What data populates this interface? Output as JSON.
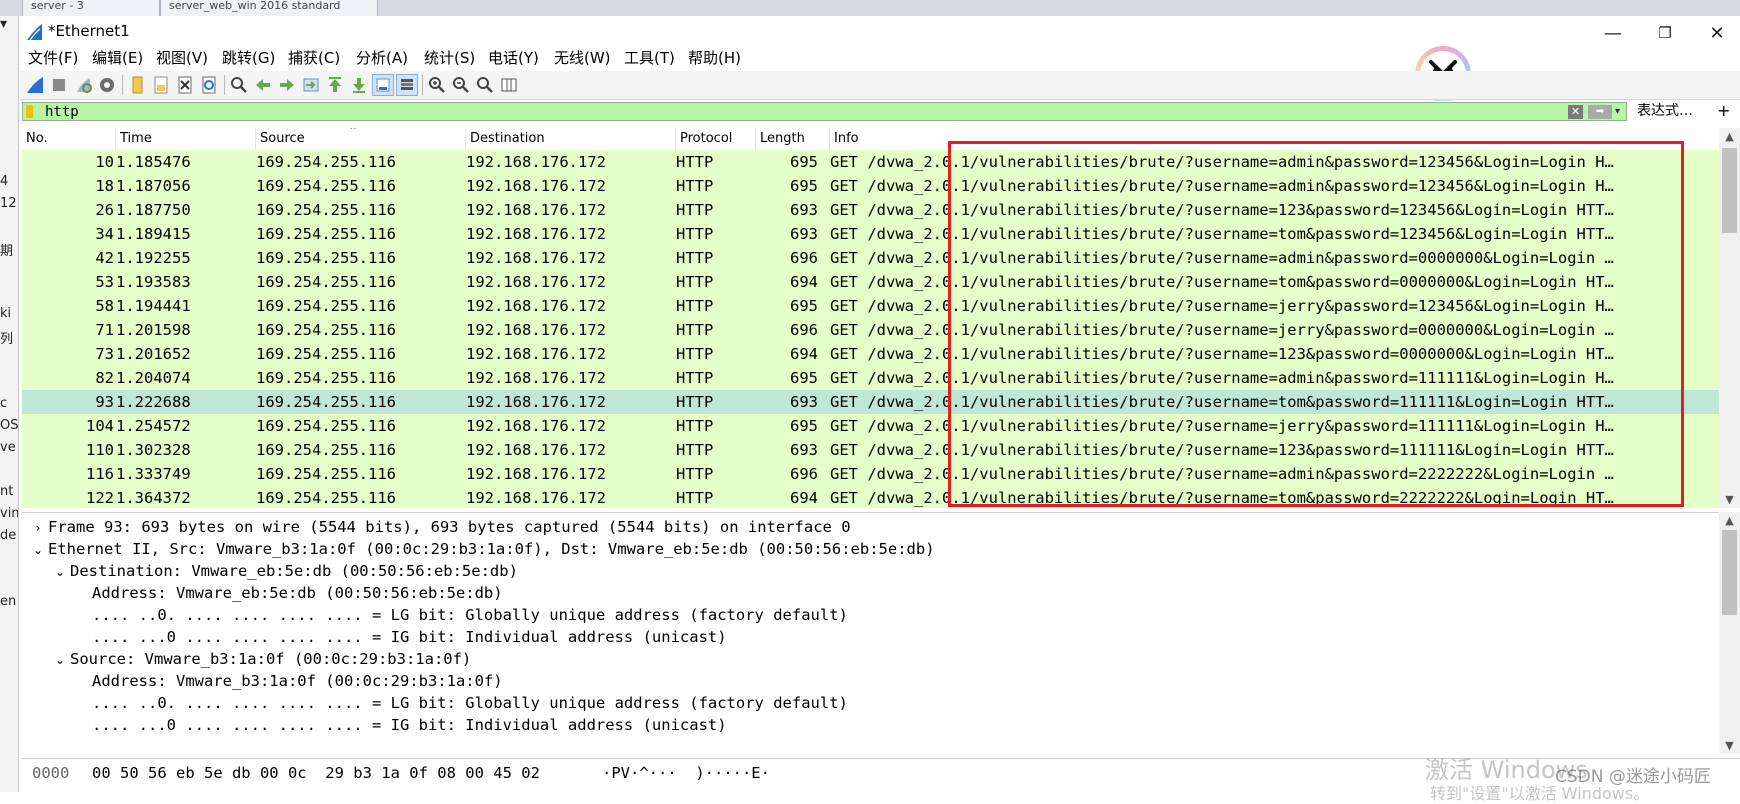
{
  "browser_tabs": [
    {
      "label": "server - 3"
    },
    {
      "label": "server_web_win 2016 standard"
    }
  ],
  "left_edge_text": [
    "4",
    "12",
    "期",
    "ki",
    "列",
    "c",
    "OS",
    "ve",
    "nt",
    "vin",
    "de",
    "en"
  ],
  "window": {
    "title": "*Ethernet1",
    "minimize": "—",
    "restore": "❐",
    "close": "✕"
  },
  "menu": [
    "文件(F)",
    "编辑(E)",
    "视图(V)",
    "跳转(G)",
    "捕获(C)",
    "分析(A)",
    "统计(S)",
    "电话(Y)",
    "无线(W)",
    "工具(T)",
    "帮助(H)"
  ],
  "toolbar_icons": [
    "shark-fin-start-icon",
    "stop-square-icon",
    "restart-capture-icon",
    "capture-options-gear-icon",
    "open-file-icon",
    "save-file-icon",
    "close-file-icon",
    "reload-file-icon",
    "find-packet-icon",
    "go-back-icon",
    "go-forward-icon",
    "go-to-packet-icon",
    "go-first-icon",
    "go-last-icon",
    "autoscroll-icon",
    "colorize-icon",
    "zoom-in-icon",
    "zoom-out-icon",
    "zoom-normal-icon",
    "resize-columns-icon"
  ],
  "filter": {
    "value": "http",
    "clear": "✕",
    "apply": "➡",
    "dropdown": "▾",
    "expression_label": "表达式…",
    "add_label": "+"
  },
  "columns": [
    "No.",
    "Time",
    "Source",
    "Destination",
    "Protocol",
    "Length",
    "Info"
  ],
  "sort_indicator": "⌃",
  "packets": [
    {
      "no": "10",
      "time": "1.185476",
      "src": "169.254.255.116",
      "dst": "192.168.176.172",
      "proto": "HTTP",
      "len": "695",
      "info": "GET /dvwa_2.0.1/vulnerabilities/brute/?username=admin&password=123456&Login=Login H…",
      "selected": false
    },
    {
      "no": "18",
      "time": "1.187056",
      "src": "169.254.255.116",
      "dst": "192.168.176.172",
      "proto": "HTTP",
      "len": "695",
      "info": "GET /dvwa_2.0.1/vulnerabilities/brute/?username=admin&password=123456&Login=Login H…",
      "selected": false
    },
    {
      "no": "26",
      "time": "1.187750",
      "src": "169.254.255.116",
      "dst": "192.168.176.172",
      "proto": "HTTP",
      "len": "693",
      "info": "GET /dvwa_2.0.1/vulnerabilities/brute/?username=123&password=123456&Login=Login HTT…",
      "selected": false
    },
    {
      "no": "34",
      "time": "1.189415",
      "src": "169.254.255.116",
      "dst": "192.168.176.172",
      "proto": "HTTP",
      "len": "693",
      "info": "GET /dvwa_2.0.1/vulnerabilities/brute/?username=tom&password=123456&Login=Login HTT…",
      "selected": false
    },
    {
      "no": "42",
      "time": "1.192255",
      "src": "169.254.255.116",
      "dst": "192.168.176.172",
      "proto": "HTTP",
      "len": "696",
      "info": "GET /dvwa_2.0.1/vulnerabilities/brute/?username=admin&password=0000000&Login=Login …",
      "selected": false
    },
    {
      "no": "53",
      "time": "1.193583",
      "src": "169.254.255.116",
      "dst": "192.168.176.172",
      "proto": "HTTP",
      "len": "694",
      "info": "GET /dvwa_2.0.1/vulnerabilities/brute/?username=tom&password=0000000&Login=Login HT…",
      "selected": false
    },
    {
      "no": "58",
      "time": "1.194441",
      "src": "169.254.255.116",
      "dst": "192.168.176.172",
      "proto": "HTTP",
      "len": "695",
      "info": "GET /dvwa_2.0.1/vulnerabilities/brute/?username=jerry&password=123456&Login=Login H…",
      "selected": false
    },
    {
      "no": "71",
      "time": "1.201598",
      "src": "169.254.255.116",
      "dst": "192.168.176.172",
      "proto": "HTTP",
      "len": "696",
      "info": "GET /dvwa_2.0.1/vulnerabilities/brute/?username=jerry&password=0000000&Login=Login …",
      "selected": false
    },
    {
      "no": "73",
      "time": "1.201652",
      "src": "169.254.255.116",
      "dst": "192.168.176.172",
      "proto": "HTTP",
      "len": "694",
      "info": "GET /dvwa_2.0.1/vulnerabilities/brute/?username=123&password=0000000&Login=Login HT…",
      "selected": false
    },
    {
      "no": "82",
      "time": "1.204074",
      "src": "169.254.255.116",
      "dst": "192.168.176.172",
      "proto": "HTTP",
      "len": "695",
      "info": "GET /dvwa_2.0.1/vulnerabilities/brute/?username=admin&password=111111&Login=Login H…",
      "selected": false
    },
    {
      "no": "93",
      "time": "1.222688",
      "src": "169.254.255.116",
      "dst": "192.168.176.172",
      "proto": "HTTP",
      "len": "693",
      "info": "GET /dvwa_2.0.1/vulnerabilities/brute/?username=tom&password=111111&Login=Login HTT…",
      "selected": true
    },
    {
      "no": "104",
      "time": "1.254572",
      "src": "169.254.255.116",
      "dst": "192.168.176.172",
      "proto": "HTTP",
      "len": "695",
      "info": "GET /dvwa_2.0.1/vulnerabilities/brute/?username=jerry&password=111111&Login=Login H…",
      "selected": false
    },
    {
      "no": "110",
      "time": "1.302328",
      "src": "169.254.255.116",
      "dst": "192.168.176.172",
      "proto": "HTTP",
      "len": "693",
      "info": "GET /dvwa_2.0.1/vulnerabilities/brute/?username=123&password=111111&Login=Login HTT…",
      "selected": false
    },
    {
      "no": "116",
      "time": "1.333749",
      "src": "169.254.255.116",
      "dst": "192.168.176.172",
      "proto": "HTTP",
      "len": "696",
      "info": "GET /dvwa_2.0.1/vulnerabilities/brute/?username=admin&password=2222222&Login=Login …",
      "selected": false
    },
    {
      "no": "122",
      "time": "1.364372",
      "src": "169.254.255.116",
      "dst": "192.168.176.172",
      "proto": "HTTP",
      "len": "694",
      "info": "GET /dvwa_2.0.1/vulnerabilities/brute/?username=tom&password=2222222&Login=Login HT…",
      "selected": false
    }
  ],
  "details": [
    {
      "arrow": "›",
      "text": "Frame 93: 693 bytes on wire (5544 bits), 693 bytes captured (5544 bits) on interface 0"
    },
    {
      "arrow": "⌄",
      "text": "Ethernet II, Src: Vmware_b3:1a:0f (00:0c:29:b3:1a:0f), Dst: Vmware_eb:5e:db (00:50:56:eb:5e:db)"
    },
    {
      "arrow": "⌄",
      "text": "Destination: Vmware_eb:5e:db (00:50:56:eb:5e:db)"
    },
    {
      "arrow": "",
      "text": "Address: Vmware_eb:5e:db (00:50:56:eb:5e:db)"
    },
    {
      "arrow": "",
      "text": ".... ..0. .... .... .... .... = LG bit: Globally unique address (factory default)"
    },
    {
      "arrow": "",
      "text": ".... ...0 .... .... .... .... = IG bit: Individual address (unicast)"
    },
    {
      "arrow": "⌄",
      "text": "Source: Vmware_b3:1a:0f (00:0c:29:b3:1a:0f)"
    },
    {
      "arrow": "",
      "text": "Address: Vmware_b3:1a:0f (00:0c:29:b3:1a:0f)"
    },
    {
      "arrow": "",
      "text": ".... ..0. .... .... .... .... = LG bit: Globally unique address (factory default)"
    },
    {
      "arrow": "",
      "text": ".... ...0 .... .... .... .... = IG bit: Individual address (unicast)"
    }
  ],
  "bytes": {
    "offset": "0000",
    "hex": "00 50 56 eb 5e db 00 0c  29 b3 1a 0f 08 00 45 02",
    "ascii": "·PV·^···  )·····E·"
  },
  "watermarks": {
    "activate_windows": "激活 Windows",
    "csdn": "CSDN @迷途小码匠",
    "activate_hint": "转到\"设置\"以激活 Windows。"
  },
  "colors": {
    "row_bg": "#e4ffc7",
    "selected_row_bg": "#bfe7d8",
    "filter_bg": "#b7f4a8",
    "highlight_box": "#e02020"
  }
}
